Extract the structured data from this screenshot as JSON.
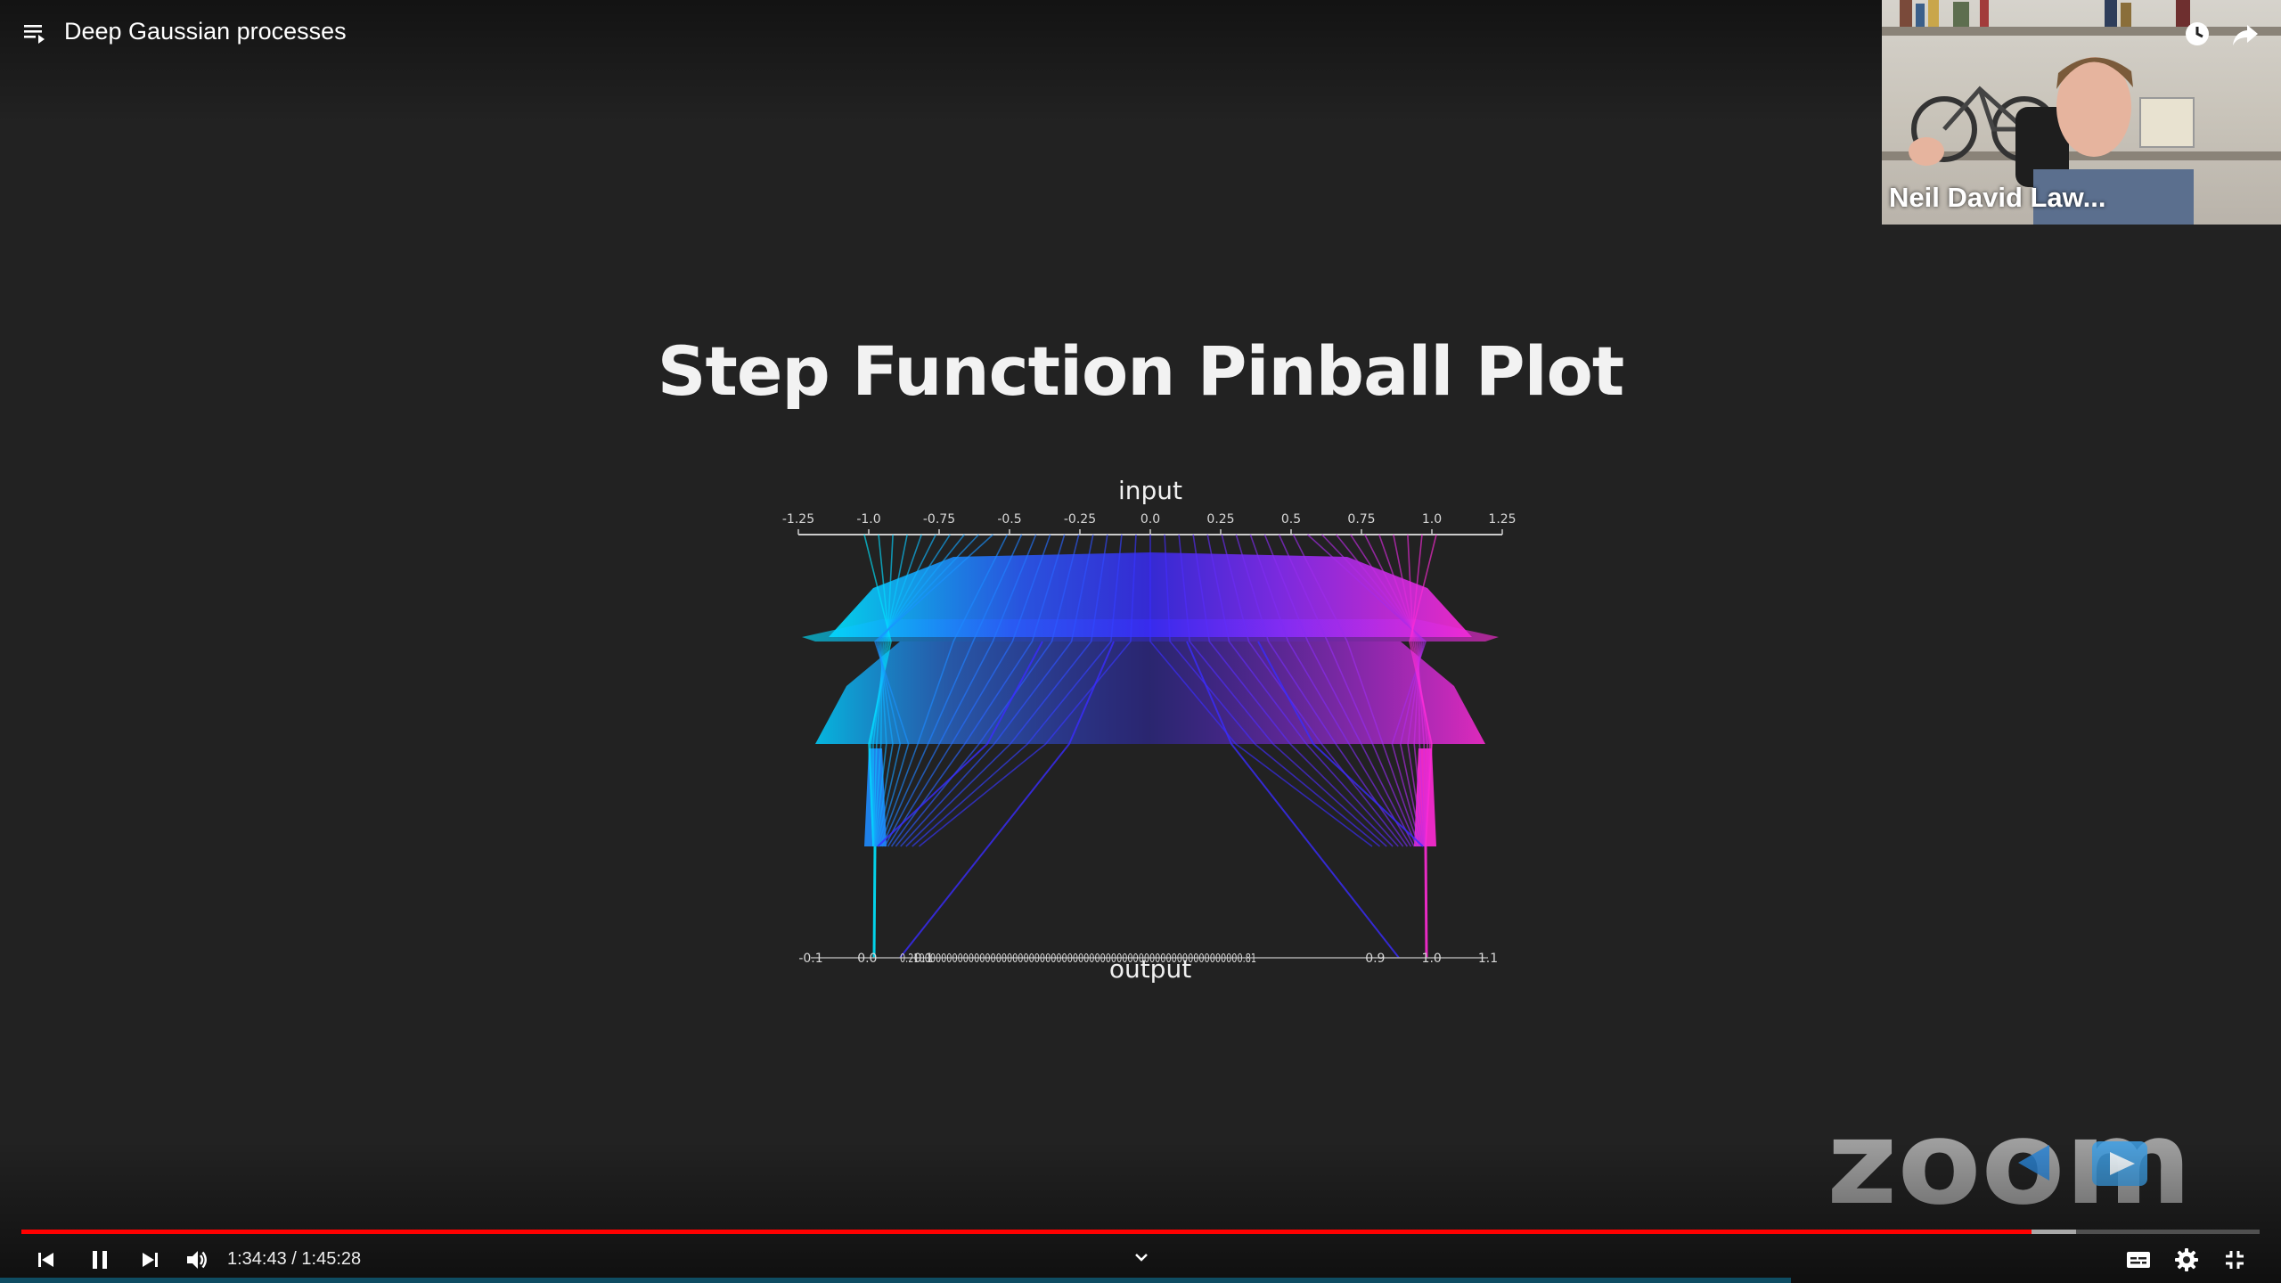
{
  "header": {
    "title": "Deep Gaussian processes",
    "playlist_icon": "playlist-icon",
    "watch_later_icon": "clock-icon",
    "share_icon": "share-icon"
  },
  "speaker": {
    "name": "Neil David Law..."
  },
  "slide": {
    "title": "Step Function Pinball Plot",
    "input_label": "input",
    "output_label": "output",
    "input_ticks": [
      "-1.25",
      "-1.0",
      "-0.75",
      "-0.5",
      "-0.25",
      "0.0",
      "0.25",
      "0.5",
      "0.75",
      "1.0",
      "1.25"
    ],
    "output_ticks": [
      "-0.1",
      "0.0",
      "0.1",
      "0.9",
      "1.0",
      "1.1"
    ],
    "output_cluster_text": "0.2100000000000000000000000000000000000000000000000000000000000.81",
    "colors": {
      "left": "#00e5ff",
      "middle": "#3a2cff",
      "right": "#ff2bd6"
    }
  },
  "watermark": {
    "text": "zoom"
  },
  "controls": {
    "current_time": "1:34:43",
    "duration": "1:45:28",
    "time_text": "1:34:43 / 1:45:28",
    "progress": 0.898,
    "buffered": 0.918,
    "accent": "#ff0000"
  }
}
